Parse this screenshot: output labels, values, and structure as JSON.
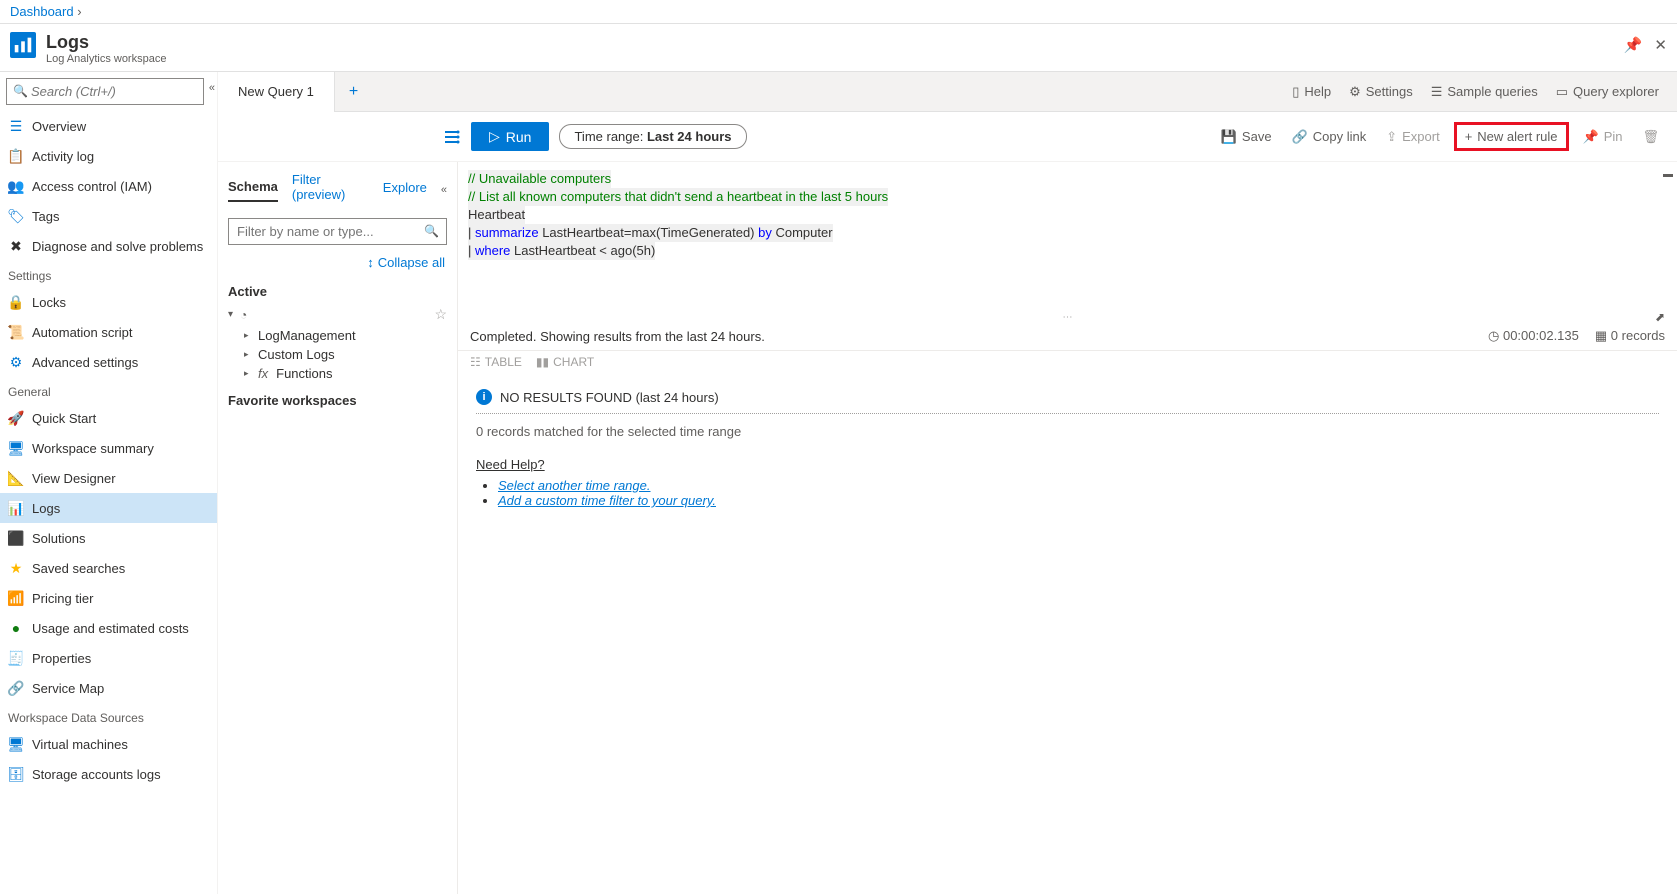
{
  "breadcrumb": {
    "root": "Dashboard"
  },
  "header": {
    "title": "Logs",
    "subtitle": "Log Analytics workspace"
  },
  "leftnav": {
    "search_placeholder": "Search (Ctrl+/)",
    "items": [
      {
        "label": "Overview"
      },
      {
        "label": "Activity log"
      },
      {
        "label": "Access control (IAM)"
      },
      {
        "label": "Tags"
      },
      {
        "label": "Diagnose and solve problems"
      }
    ],
    "sec_settings": "Settings",
    "settings_items": [
      {
        "label": "Locks"
      },
      {
        "label": "Automation script"
      },
      {
        "label": "Advanced settings"
      }
    ],
    "sec_general": "General",
    "general_items": [
      {
        "label": "Quick Start"
      },
      {
        "label": "Workspace summary"
      },
      {
        "label": "View Designer"
      },
      {
        "label": "Logs",
        "selected": true
      },
      {
        "label": "Solutions"
      },
      {
        "label": "Saved searches"
      },
      {
        "label": "Pricing tier"
      },
      {
        "label": "Usage and estimated costs"
      },
      {
        "label": "Properties"
      },
      {
        "label": "Service Map"
      }
    ],
    "sec_wds": "Workspace Data Sources",
    "wds_items": [
      {
        "label": "Virtual machines"
      },
      {
        "label": "Storage accounts logs"
      }
    ]
  },
  "tabs": {
    "tab1": "New Query 1",
    "help": "Help",
    "settings": "Settings",
    "sample": "Sample queries",
    "explorer": "Query explorer"
  },
  "toolbar": {
    "run": "Run",
    "timerange_prefix": "Time range: ",
    "timerange_value": "Last 24 hours",
    "save": "Save",
    "copy": "Copy link",
    "export": "Export",
    "newalert": "New alert rule",
    "pin": "Pin"
  },
  "schema": {
    "tab_schema": "Schema",
    "tab_filter": "Filter (preview)",
    "tab_explore": "Explore",
    "filter_placeholder": "Filter by name or type...",
    "collapse_all": "Collapse all",
    "active": "Active",
    "nodes": {
      "logmgmt": "LogManagement",
      "custom": "Custom Logs",
      "fx": "Functions"
    },
    "fav": "Favorite workspaces"
  },
  "code": {
    "l1": "// Unavailable computers",
    "l2": "// List all known computers that didn't send a heartbeat in the last 5 hours",
    "l3": "Heartbeat",
    "l4a": "summarize",
    "l4b": " LastHeartbeat=max(TimeGenerated) ",
    "l4c": "by",
    "l4d": " Computer",
    "l5a": "where",
    "l5b": " LastHeartbeat < ago(5h)"
  },
  "results": {
    "status": "Completed. Showing results from the last 24 hours.",
    "timer": "00:00:02.135",
    "records": "0 records",
    "tab_table": "TABLE",
    "tab_chart": "CHART",
    "no_results": "NO RESULTS FOUND ",
    "no_results_suffix": " (last 24 hours)",
    "zero": "0 records matched for the selected time range",
    "need_help": "Need Help?",
    "help1": "Select another time range.",
    "help2": "Add a custom time filter to your query."
  }
}
